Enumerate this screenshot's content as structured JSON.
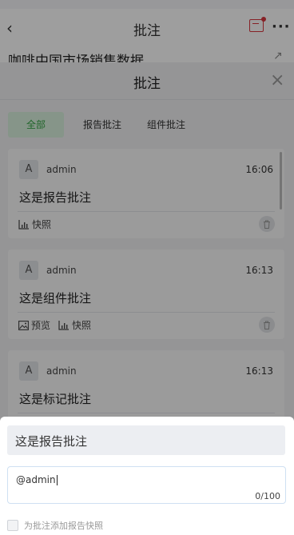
{
  "app_header": {
    "back_glyph": "‹",
    "title": "批注",
    "more_glyph": "···"
  },
  "report": {
    "title": "咖啡中国市场销售数据"
  },
  "modal": {
    "title": "批注",
    "close_glyph": "×",
    "tabs": [
      {
        "label": "全部",
        "active": true
      },
      {
        "label": "报告批注",
        "active": false
      },
      {
        "label": "组件批注",
        "active": false
      }
    ],
    "comments": [
      {
        "avatar": "A",
        "user": "admin",
        "time": "16:06",
        "text": "这是报告批注",
        "actions": [
          "快照"
        ]
      },
      {
        "avatar": "A",
        "user": "admin",
        "time": "16:13",
        "text": "这是组件批注",
        "actions": [
          "预览",
          "快照"
        ]
      },
      {
        "avatar": "A",
        "user": "admin",
        "time": "16:13",
        "text": "这是标记批注",
        "actions": []
      }
    ]
  },
  "reply_sheet": {
    "quoted_text": "这是报告批注",
    "input_value": "@admin",
    "char_count": "0/100",
    "snapshot_checkbox_label": "为批注添加报告快照",
    "snapshot_checked": false
  },
  "colors": {
    "accent_green": "#36a546",
    "accent_red": "#d9363e"
  }
}
